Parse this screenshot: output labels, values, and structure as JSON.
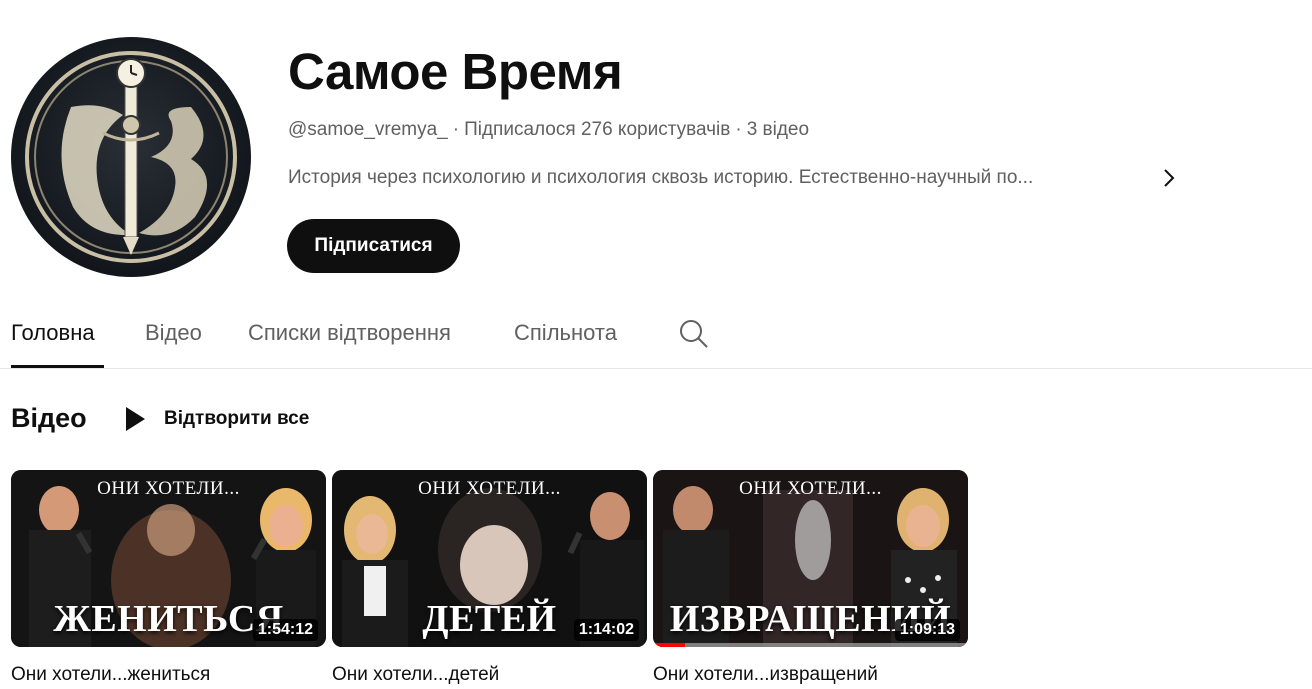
{
  "channel": {
    "name": "Самое Время",
    "handle": "@samoe_vremya_",
    "subscribers": "Підписалося 276 користувачів",
    "video_count": "3 відео",
    "separator": "·",
    "description": "История через психологию и психология сквозь историю. Естественно-научный по...",
    "subscribe_label": "Підписатися",
    "avatar_icon": "monogram-clock-sword-icon"
  },
  "tabs": [
    {
      "label": "Головна",
      "active": true
    },
    {
      "label": "Відео",
      "active": false
    },
    {
      "label": "Списки відтворення",
      "active": false
    },
    {
      "label": "Спільнота",
      "active": false
    }
  ],
  "section": {
    "title": "Відео",
    "play_all_label": "Відтворити все"
  },
  "videos": [
    {
      "thumb_top": "ОНИ ХОТЕЛИ...",
      "thumb_big": "ЖЕНИТЬСЯ",
      "duration": "1:54:12",
      "title": "Они хотели...жениться",
      "progress": 0
    },
    {
      "thumb_top": "ОНИ ХОТЕЛИ...",
      "thumb_big": "ДЕТЕЙ",
      "duration": "1:14:02",
      "title": "Они хотели...детей",
      "progress": 0
    },
    {
      "thumb_top": "ОНИ ХОТЕЛИ...",
      "thumb_big": "ИЗВРАЩЕНИЙ",
      "duration": "1:09:13",
      "title": "Они хотели...извращений",
      "progress": 0.1
    }
  ],
  "colors": {
    "text_primary": "#0f0f0f",
    "text_secondary": "#606060",
    "progress": "#ff0000",
    "subscribe_bg": "#0f0f0f"
  }
}
